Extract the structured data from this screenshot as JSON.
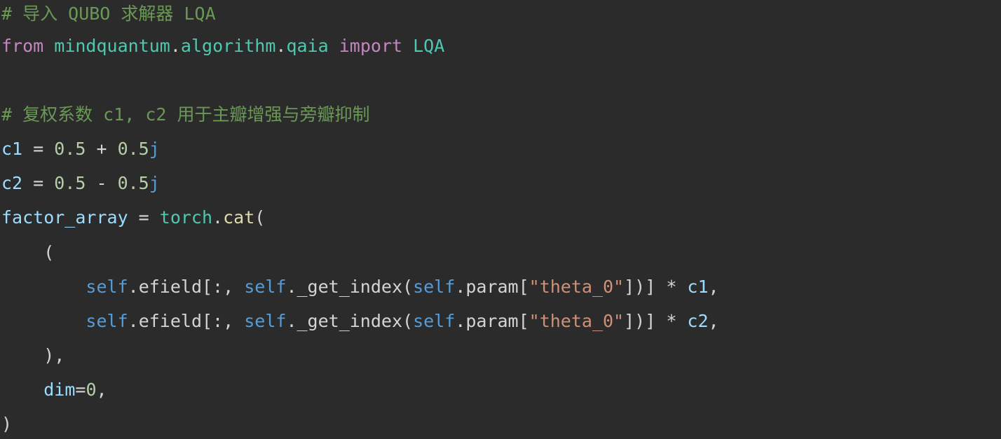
{
  "theme": {
    "background": "#2b2b2b",
    "default": "#d4d4d4",
    "comment": "#6a9955",
    "keyword": "#c586c0",
    "variable": "#9cdcfe",
    "module": "#4ec9b0",
    "function": "#dcdcaa",
    "number": "#b5cea8",
    "string": "#ce9178",
    "self": "#569cd6"
  },
  "code": {
    "lines": [
      [
        {
          "text": "# 导入 QUBO 求解器 LQA",
          "type": "comment"
        }
      ],
      [
        {
          "text": "from",
          "type": "keyword"
        },
        {
          "text": " ",
          "type": "default"
        },
        {
          "text": "mindquantum",
          "type": "module"
        },
        {
          "text": ".",
          "type": "default"
        },
        {
          "text": "algorithm",
          "type": "module"
        },
        {
          "text": ".",
          "type": "default"
        },
        {
          "text": "qaia",
          "type": "module"
        },
        {
          "text": " ",
          "type": "default"
        },
        {
          "text": "import",
          "type": "keyword"
        },
        {
          "text": " ",
          "type": "default"
        },
        {
          "text": "LQA",
          "type": "module"
        }
      ],
      [],
      [
        {
          "text": "# 复权系数 c1, c2 用于主瓣增强与旁瓣抑制",
          "type": "comment"
        }
      ],
      [
        {
          "text": "c1",
          "type": "variable"
        },
        {
          "text": " = ",
          "type": "default"
        },
        {
          "text": "0.5",
          "type": "number"
        },
        {
          "text": " + ",
          "type": "default"
        },
        {
          "text": "0.5",
          "type": "number"
        },
        {
          "text": "j",
          "type": "self"
        }
      ],
      [
        {
          "text": "c2",
          "type": "variable"
        },
        {
          "text": " = ",
          "type": "default"
        },
        {
          "text": "0.5",
          "type": "number"
        },
        {
          "text": " - ",
          "type": "default"
        },
        {
          "text": "0.5",
          "type": "number"
        },
        {
          "text": "j",
          "type": "self"
        }
      ],
      [
        {
          "text": "factor_array",
          "type": "variable"
        },
        {
          "text": " = ",
          "type": "default"
        },
        {
          "text": "torch",
          "type": "module"
        },
        {
          "text": ".",
          "type": "default"
        },
        {
          "text": "cat",
          "type": "function"
        },
        {
          "text": "(",
          "type": "default"
        }
      ],
      [
        {
          "text": "    (",
          "type": "default"
        }
      ],
      [
        {
          "text": "        ",
          "type": "default"
        },
        {
          "text": "self",
          "type": "self"
        },
        {
          "text": ".efield[:, ",
          "type": "default"
        },
        {
          "text": "self",
          "type": "self"
        },
        {
          "text": "._get_index(",
          "type": "default"
        },
        {
          "text": "self",
          "type": "self"
        },
        {
          "text": ".param[",
          "type": "default"
        },
        {
          "text": "\"theta_0\"",
          "type": "string"
        },
        {
          "text": "])] * ",
          "type": "default"
        },
        {
          "text": "c1",
          "type": "variable"
        },
        {
          "text": ",",
          "type": "default"
        }
      ],
      [
        {
          "text": "        ",
          "type": "default"
        },
        {
          "text": "self",
          "type": "self"
        },
        {
          "text": ".efield[:, ",
          "type": "default"
        },
        {
          "text": "self",
          "type": "self"
        },
        {
          "text": "._get_index(",
          "type": "default"
        },
        {
          "text": "self",
          "type": "self"
        },
        {
          "text": ".param[",
          "type": "default"
        },
        {
          "text": "\"theta_0\"",
          "type": "string"
        },
        {
          "text": "])] * ",
          "type": "default"
        },
        {
          "text": "c2",
          "type": "variable"
        },
        {
          "text": ",",
          "type": "default"
        }
      ],
      [
        {
          "text": "    ),",
          "type": "default"
        }
      ],
      [
        {
          "text": "    ",
          "type": "default"
        },
        {
          "text": "dim",
          "type": "variable"
        },
        {
          "text": "=",
          "type": "default"
        },
        {
          "text": "0",
          "type": "number"
        },
        {
          "text": ",",
          "type": "default"
        }
      ],
      [
        {
          "text": ")",
          "type": "default"
        }
      ]
    ]
  }
}
